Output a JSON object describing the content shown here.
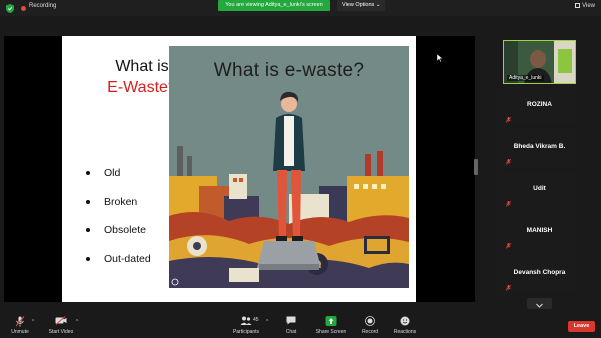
{
  "topbar": {
    "recording_label": "Recording",
    "viewing_label": "You are viewing Aditya_e_lunki's screen",
    "view_options_label": "View Options",
    "view_label": "View",
    "accent_green": "#23a83e",
    "record_red": "#e04a3a"
  },
  "slide": {
    "question_line1": "What is",
    "question_red": "E-Waste",
    "question_mark": "?",
    "bullets": [
      "Old",
      "Broken",
      "Obsolete",
      "Out-dated"
    ],
    "illustration_title": "What is e-waste?",
    "red": "#d41f1f"
  },
  "self_view": {
    "name": "Aditya_e_lunki"
  },
  "participants": [
    {
      "name": "ROZINA"
    },
    {
      "name": "Bheda Vikram B."
    },
    {
      "name": "Udit"
    },
    {
      "name": "MANISH"
    },
    {
      "name": "Devansh Chopra"
    }
  ],
  "toolbar": {
    "unmute": "Unmute",
    "start_video": "Start Video",
    "participants": "Participants",
    "participants_count": "45",
    "chat": "Chat",
    "share_screen": "Share Screen",
    "record": "Record",
    "reactions": "Reactions",
    "leave": "Leave",
    "leave_color": "#d9382f"
  }
}
